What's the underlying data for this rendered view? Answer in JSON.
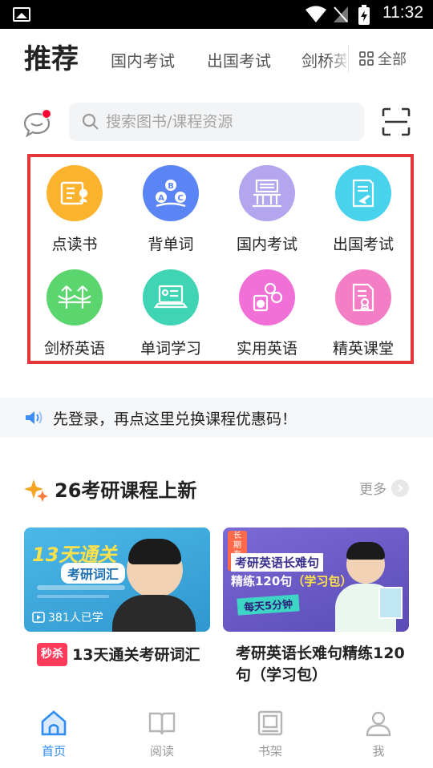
{
  "status_bar": {
    "time": "11:32"
  },
  "tabs": {
    "active": "推荐",
    "items": [
      "国内考试",
      "出国考试",
      "剑桥英语"
    ],
    "all_label": "全部"
  },
  "search": {
    "placeholder": "搜索图书/课程资源"
  },
  "features": [
    {
      "label": "点读书",
      "icon": "book-reading-icon",
      "color": "#fbb32d"
    },
    {
      "label": "背单词",
      "icon": "abc-letters-icon",
      "color": "#5b84f4"
    },
    {
      "label": "国内考试",
      "icon": "building-icon",
      "color": "#b3a5ee"
    },
    {
      "label": "出国考试",
      "icon": "airplane-document-icon",
      "color": "#48d2ec"
    },
    {
      "label": "剑桥英语",
      "icon": "bridge-icon",
      "color": "#5bd56d"
    },
    {
      "label": "单词学习",
      "icon": "laptop-icon",
      "color": "#3fd4b3"
    },
    {
      "label": "实用英语",
      "icon": "speech-book-icon",
      "color": "#f170d8"
    },
    {
      "label": "精英课堂",
      "icon": "certificate-icon",
      "color": "#f47ec6"
    }
  ],
  "notice": {
    "text": "先登录，再点这里兑换课程优惠码！"
  },
  "section": {
    "title": "26考研课程上新",
    "more_label": "更多"
  },
  "courses": [
    {
      "badge": "秒杀",
      "title": "13天通关考研词汇",
      "cover": {
        "headline": "13天通关",
        "subhead": "考研词汇",
        "learners": "381人已学",
        "bg": "#37a6d9"
      }
    },
    {
      "title": "考研英语长难句精练120句（学习包）",
      "cover": {
        "tag": "长期有效",
        "headline": "考研英语长难句",
        "subhead": "精练120句",
        "pack": "（学习包）",
        "slogan": "每天5分钟",
        "bg": "#6b5bc4"
      }
    }
  ],
  "bottom_nav": [
    {
      "label": "首页",
      "icon": "home-icon",
      "active": true
    },
    {
      "label": "阅读",
      "icon": "open-book-icon",
      "active": false
    },
    {
      "label": "书架",
      "icon": "bookshelf-icon",
      "active": false
    },
    {
      "label": "我",
      "icon": "person-icon",
      "active": false
    }
  ]
}
